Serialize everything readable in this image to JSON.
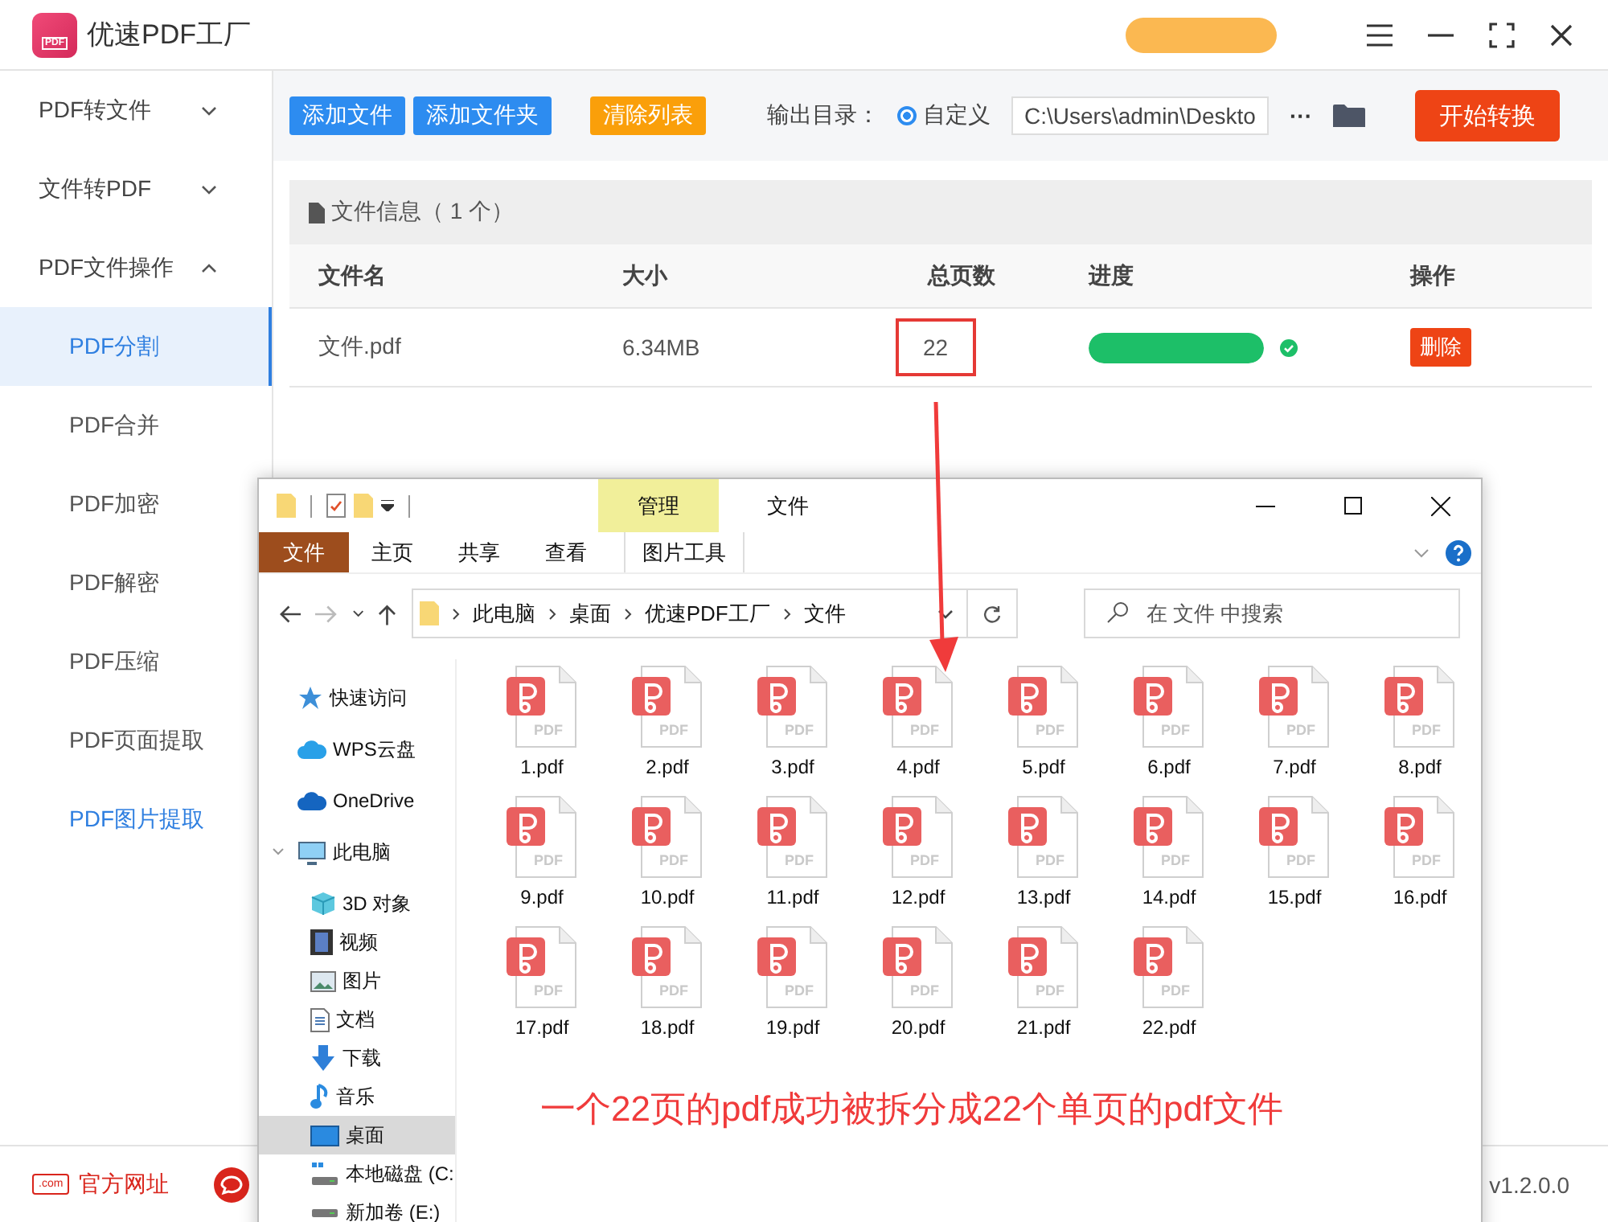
{
  "app": {
    "logo_text": "PDF",
    "title": "优速PDF工厂"
  },
  "sidebar": {
    "items": [
      {
        "label": "PDF转文件",
        "expanded": false
      },
      {
        "label": "文件转PDF",
        "expanded": false
      },
      {
        "label": "PDF文件操作",
        "expanded": true,
        "children": [
          {
            "label": "PDF分割",
            "selected": true,
            "hover": false
          },
          {
            "label": "PDF合并",
            "selected": false,
            "hover": false
          },
          {
            "label": "PDF加密",
            "selected": false,
            "hover": false
          },
          {
            "label": "PDF解密",
            "selected": false,
            "hover": false
          },
          {
            "label": "PDF压缩",
            "selected": false,
            "hover": false
          },
          {
            "label": "PDF页面提取",
            "selected": false,
            "hover": false
          },
          {
            "label": "PDF图片提取",
            "selected": false,
            "hover": true
          }
        ]
      }
    ]
  },
  "toolbar": {
    "buttons": [
      {
        "label": "添加文件",
        "kind": "primary"
      },
      {
        "label": "添加文件夹",
        "kind": "primary"
      },
      {
        "label": "清除列表",
        "kind": "warning"
      }
    ],
    "output_label": "输出目录：",
    "radio": {
      "label": "自定义",
      "checked": true
    },
    "path": "C:\\Users\\admin\\Deskto",
    "more": "···",
    "start_button": "开始转换"
  },
  "file_panel": {
    "title": "文件信息（ 1 个）",
    "columns": [
      "文件名",
      "大小",
      "总页数",
      "进度",
      "操作"
    ],
    "rows": [
      {
        "name": "文件.pdf",
        "size": "6.34MB",
        "pages": "22",
        "level": 1,
        "done": true,
        "action": "删除"
      }
    ]
  },
  "footer": {
    "website": "官方网址",
    "website_icon_text": ".com",
    "version": "v1.2.0.0"
  },
  "explorer": {
    "context_tab": "管理",
    "title": "文件",
    "ribbon_tabs": [
      {
        "label": "文件",
        "selected": true
      },
      {
        "label": "主页",
        "selected": false
      },
      {
        "label": "共享",
        "selected": false
      },
      {
        "label": "查看",
        "selected": false
      },
      {
        "label": "图片工具",
        "selected": false
      }
    ],
    "breadcrumbs": [
      "此电脑",
      "桌面",
      "优速PDF工厂",
      "文件"
    ],
    "search_placeholder": "在 文件 中搜索",
    "nav": [
      {
        "label": "快速访问",
        "kind": "star",
        "selected": false
      },
      {
        "label": "WPS云盘",
        "kind": "cloud",
        "selected": false
      },
      {
        "label": "OneDrive",
        "kind": "onedrive",
        "selected": false
      },
      {
        "label": "此电脑",
        "kind": "pc",
        "selected": false,
        "expanded": true,
        "children": [
          {
            "label": "3D 对象",
            "kind": "cube",
            "selected": false
          },
          {
            "label": "视频",
            "kind": "film",
            "selected": false
          },
          {
            "label": "图片",
            "kind": "image",
            "selected": false
          },
          {
            "label": "文档",
            "kind": "doc",
            "selected": false
          },
          {
            "label": "下载",
            "kind": "download",
            "selected": false
          },
          {
            "label": "音乐",
            "kind": "music",
            "selected": false
          },
          {
            "label": "桌面",
            "kind": "desktop",
            "selected": true
          },
          {
            "label": "本地磁盘 (C:",
            "kind": "drivec",
            "selected": false
          },
          {
            "label": "新加卷 (E:)",
            "kind": "drive",
            "selected": false
          }
        ]
      }
    ],
    "files": [
      {
        "name": "1.pdf",
        "icon_label": "PDF"
      },
      {
        "name": "2.pdf",
        "icon_label": "PDF"
      },
      {
        "name": "3.pdf",
        "icon_label": "PDF"
      },
      {
        "name": "4.pdf",
        "icon_label": "PDF"
      },
      {
        "name": "5.pdf",
        "icon_label": "PDF"
      },
      {
        "name": "6.pdf",
        "icon_label": "PDF"
      },
      {
        "name": "7.pdf",
        "icon_label": "PDF"
      },
      {
        "name": "8.pdf",
        "icon_label": "PDF"
      },
      {
        "name": "9.pdf",
        "icon_label": "PDF"
      },
      {
        "name": "10.pdf",
        "icon_label": "PDF"
      },
      {
        "name": "11.pdf",
        "icon_label": "PDF"
      },
      {
        "name": "12.pdf",
        "icon_label": "PDF"
      },
      {
        "name": "13.pdf",
        "icon_label": "PDF"
      },
      {
        "name": "14.pdf",
        "icon_label": "PDF"
      },
      {
        "name": "15.pdf",
        "icon_label": "PDF"
      },
      {
        "name": "16.pdf",
        "icon_label": "PDF"
      },
      {
        "name": "17.pdf",
        "icon_label": "PDF"
      },
      {
        "name": "18.pdf",
        "icon_label": "PDF"
      },
      {
        "name": "19.pdf",
        "icon_label": "PDF"
      },
      {
        "name": "20.pdf",
        "icon_label": "PDF"
      },
      {
        "name": "21.pdf",
        "icon_label": "PDF"
      },
      {
        "name": "22.pdf",
        "icon_label": "PDF"
      }
    ]
  },
  "caption": "一个22页的pdf成功被拆分成22个单页的pdf文件"
}
